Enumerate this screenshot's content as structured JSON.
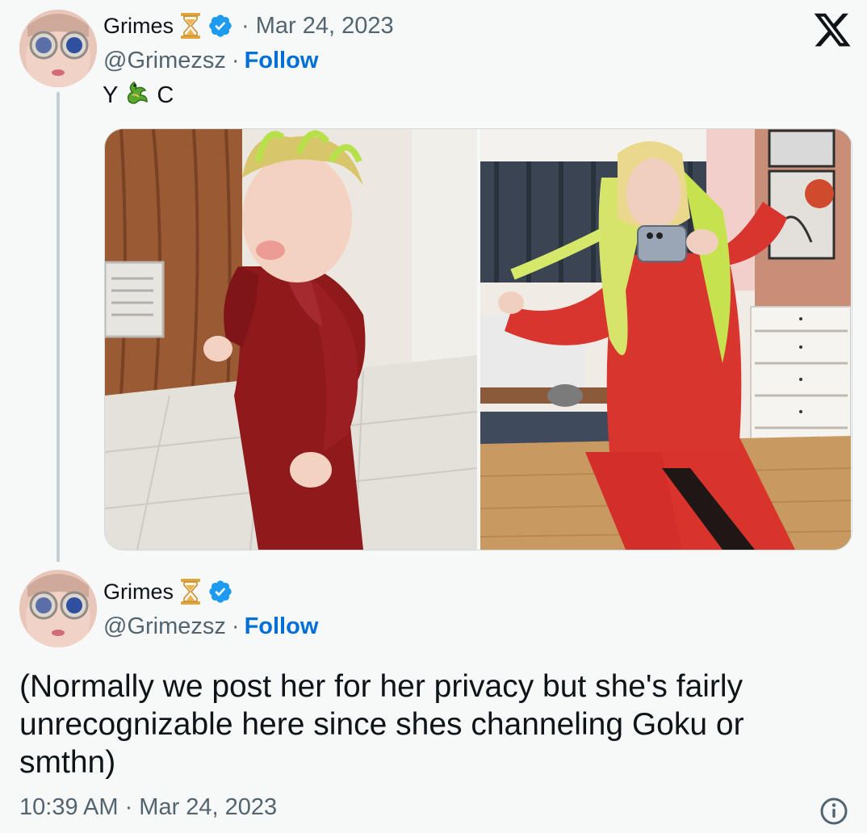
{
  "colors": {
    "link": "#006fd6",
    "verified": "#1d9bf0",
    "muted": "#536471",
    "text": "#0f1419",
    "background": "#f7f9f9"
  },
  "icons": {
    "close": "x-logo-icon",
    "hourglass": "hourglass-icon",
    "verified": "verified-badge-icon",
    "dragon": "dragon-emoji",
    "info": "info-icon"
  },
  "tweet1": {
    "name": "Grimes",
    "date": "· Mar 24, 2023",
    "handle": "@Grimezsz",
    "separator": "·",
    "follow": "Follow",
    "text_before": "Y",
    "text_after": "C"
  },
  "tweet2": {
    "name": "Grimes",
    "handle": "@Grimezsz",
    "separator": "·",
    "follow": "Follow",
    "text": "(Normally we post her for her privacy but she's fairly unrecognizable here since shes channeling Goku or smthn)",
    "timestamp": "10:39 AM · Mar 24, 2023"
  }
}
